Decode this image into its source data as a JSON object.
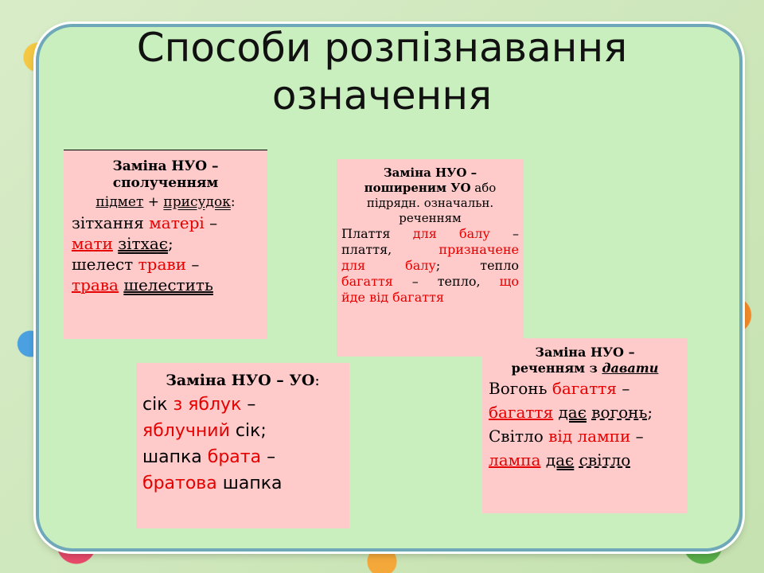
{
  "slide": {
    "title_line1": "Способи розпізнавання",
    "title_line2": "означення"
  },
  "box1": {
    "header_line1": "Заміна  НУО –",
    "header_line2": "сполученням",
    "sub_a": "підмет",
    "sub_plus": " + ",
    "sub_b": "присудок",
    "sub_colon": ":",
    "l1_a": "зітхання ",
    "l1_red": "матері",
    "l1_b": " –",
    "l2_red": "мати",
    "l2_sp": " ",
    "l2_b": "зітхає",
    "l2_end": ";",
    "l3_a": "шелест ",
    "l3_red": "трави",
    "l3_b": " –",
    "l4_red": "трава",
    "l4_sp": " ",
    "l4_b": "шелестить"
  },
  "box2": {
    "header_line1": "Заміна НУО –",
    "header_line2_bold": "поширеним УО",
    "header_line2_rest": " або",
    "header_line3": "підрядн. означальн.",
    "header_line4": "реченням",
    "l1_a": "Плаття ",
    "l1_red": "для балу",
    "l1_b": " –",
    "l2_a": "плаття, ",
    "l2_red": "призначене",
    "l3_red": "для балу",
    "l3_b": "; тепло",
    "l4_red": "багаття",
    "l4_b": " – тепло, ",
    "l4_red2": "що",
    "l5_red": "йде від багаття"
  },
  "box3": {
    "header": "Заміна НУО – УО",
    "header_colon": ":",
    "l1_a": "сік ",
    "l1_red": "з яблук",
    "l1_b": " –",
    "l2_red": "яблучний",
    "l2_b": " сік;",
    "l3_a": "шапка ",
    "l3_red": "брата",
    "l3_b": " –",
    "l4_red": "братова",
    "l4_b": " шапка"
  },
  "box4": {
    "header_line1": "Заміна НУО –",
    "header_line2_a": "реченням з ",
    "header_line2_b": "давати",
    "l1_a": "Вогонь ",
    "l1_red": "багаття",
    "l1_b": " –",
    "l2_red": "багаття",
    "l2_sp": " ",
    "l2_b": "дає",
    "l2_sp2": " ",
    "l2_c": "вогонь",
    "l2_end": ";",
    "l3_a": "Світло ",
    "l3_red": "від лампи",
    "l3_b": " –",
    "l4_red": "лампа",
    "l4_sp": " ",
    "l4_b": "дає",
    "l4_sp2": " ",
    "l4_c": "світло"
  }
}
